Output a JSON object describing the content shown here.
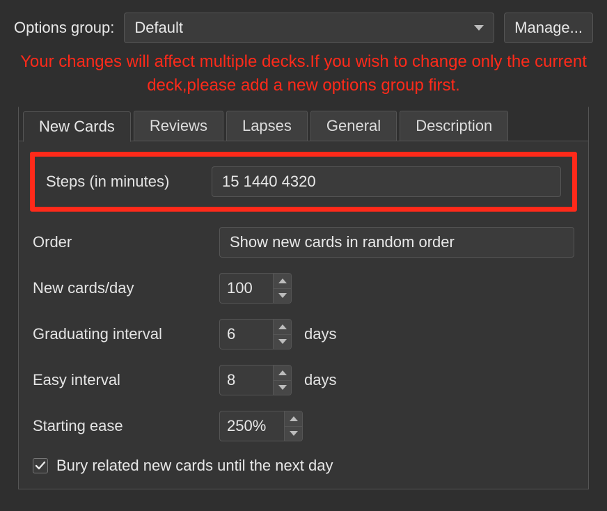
{
  "header": {
    "options_group_label": "Options group:",
    "options_group_value": "Default",
    "manage_label": "Manage..."
  },
  "warning": "Your changes will affect multiple decks.If you wish to change only the current deck,please add a new options group first.",
  "tabs": {
    "new_cards": "New Cards",
    "reviews": "Reviews",
    "lapses": "Lapses",
    "general": "General",
    "description": "Description"
  },
  "form": {
    "steps_label": "Steps (in minutes)",
    "steps_value": "15 1440 4320",
    "order_label": "Order",
    "order_value": "Show new cards in random order",
    "new_per_day_label": "New cards/day",
    "new_per_day_value": "100",
    "grad_interval_label": "Graduating interval",
    "grad_interval_value": "6",
    "easy_interval_label": "Easy interval",
    "easy_interval_value": "8",
    "days_suffix": "days",
    "starting_ease_label": "Starting ease",
    "starting_ease_value": "250%",
    "bury_label": "Bury related new cards until the next day",
    "bury_checked": true
  }
}
